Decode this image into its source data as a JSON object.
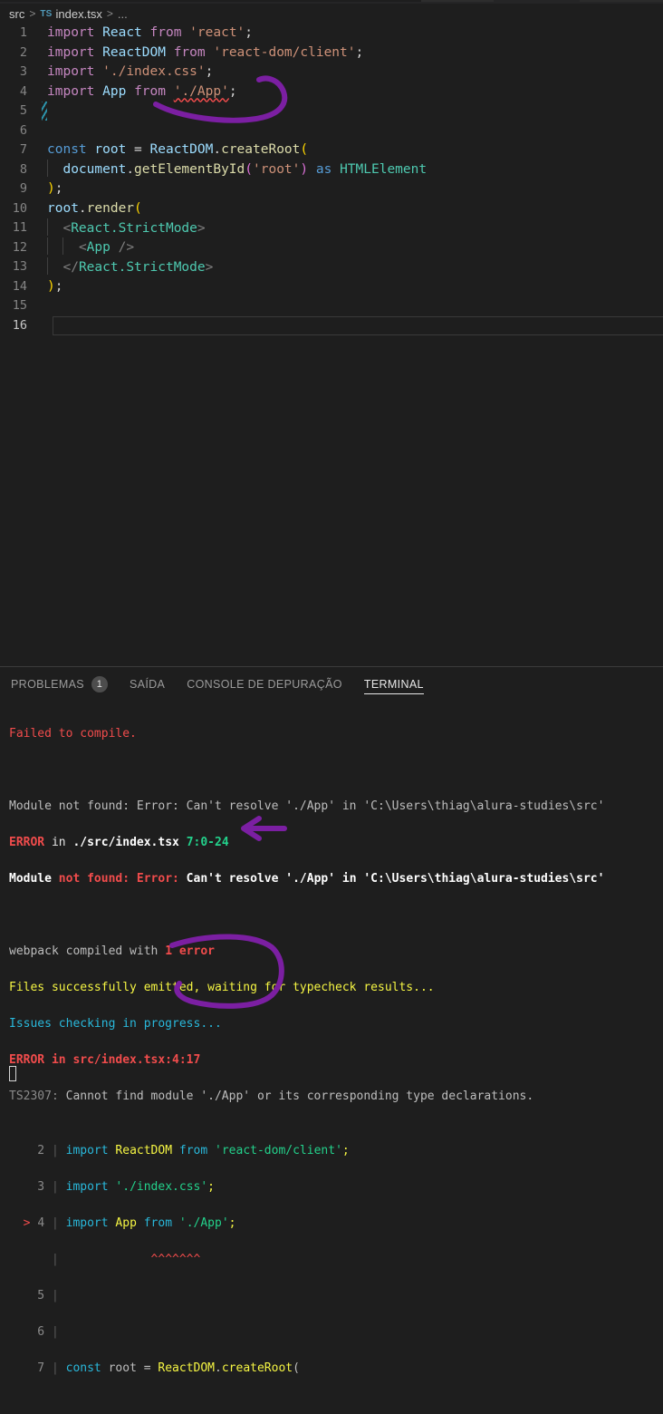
{
  "window": {
    "app": "Visual Studio Code",
    "theme": "Dark+"
  },
  "breadcrumb": {
    "root": "src",
    "separator": ">",
    "file_icon": "TS",
    "file": "index.tsx",
    "overflow": "..."
  },
  "editor": {
    "language": "typescriptreact",
    "file": "index.tsx",
    "current_line": 16,
    "lines": [
      {
        "n": "1",
        "text": "import React from 'react';"
      },
      {
        "n": "2",
        "text": "import ReactDOM from 'react-dom/client';"
      },
      {
        "n": "3",
        "text": "import './index.css';"
      },
      {
        "n": "4",
        "text": "import App from './App';"
      },
      {
        "n": "5",
        "text": ""
      },
      {
        "n": "6",
        "text": ""
      },
      {
        "n": "7",
        "text": "const root = ReactDOM.createRoot("
      },
      {
        "n": "8",
        "text": "  document.getElementById('root') as HTMLElement"
      },
      {
        "n": "9",
        "text": ");"
      },
      {
        "n": "10",
        "text": "root.render("
      },
      {
        "n": "11",
        "text": "  <React.StrictMode>"
      },
      {
        "n": "12",
        "text": "    <App />"
      },
      {
        "n": "13",
        "text": "  </React.StrictMode>"
      },
      {
        "n": "14",
        "text": ");"
      },
      {
        "n": "15",
        "text": ""
      },
      {
        "n": "16",
        "text": ""
      }
    ]
  },
  "panel": {
    "tabs": [
      {
        "label": "PROBLEMAS",
        "badge": "1",
        "active": false
      },
      {
        "label": "SAÍDA",
        "badge": "",
        "active": false
      },
      {
        "label": "CONSOLE DE DEPURAÇÃO",
        "badge": "",
        "active": false
      },
      {
        "label": "TERMINAL",
        "badge": "",
        "active": true
      }
    ],
    "terminal": {
      "l1": "Failed to compile.",
      "l2": "",
      "l3": "Module not found: Error: Can't resolve './App' in 'C:\\Users\\thiag\\alura-studies\\src'",
      "l4_error": "ERROR",
      "l4_in": " in ",
      "l4_path": "./src/index.tsx",
      "l4_loc": "7:0-24",
      "l5_a": "Module",
      "l5_b": " not found:",
      "l5_c": " Error:",
      "l5_d": " Can't resolve './App' in 'C:\\Users\\thiag\\alura-studies\\src'",
      "l6": "",
      "l7_a": "webpack compiled with ",
      "l7_b": "1 error",
      "l8": "Files successfully emitted, waiting for typecheck results...",
      "l9": "Issues checking in progress...",
      "l10": "ERROR in src/index.tsx:4:17",
      "l11_code": "TS2307:",
      "l11_msg": " Cannot find module './App' or its corresponding type declarations.",
      "snippet": [
        {
          "n": "2",
          "marker": "",
          "text": "import ReactDOM from 'react-dom/client';"
        },
        {
          "n": "3",
          "marker": "",
          "text": "import './index.css';"
        },
        {
          "n": "4",
          "marker": ">",
          "text": "import App from './App';"
        },
        {
          "n": "",
          "marker": "",
          "text": "           ~~~~~~~"
        },
        {
          "n": "5",
          "marker": "",
          "text": ""
        },
        {
          "n": "6",
          "marker": "",
          "text": ""
        },
        {
          "n": "7",
          "marker": "",
          "text": "const root = ReactDOM.createRoot("
        }
      ]
    }
  },
  "annotations": {
    "ink_color": "#7b1fa2",
    "shapes": [
      {
        "name": "circle-around-app-import",
        "target": "editor line 4 './App'"
      },
      {
        "name": "arrow-pointing-at-error-count",
        "target": "webpack compiled with 1 error"
      },
      {
        "name": "circle-around-terminal-app-import",
        "target": "terminal snippet line 4 './App'"
      }
    ]
  },
  "colors": {
    "background": "#1e1e1e",
    "error_red": "#f14c4c",
    "ink_purple": "#7b1fa2",
    "accent_blue": "#519aba"
  }
}
